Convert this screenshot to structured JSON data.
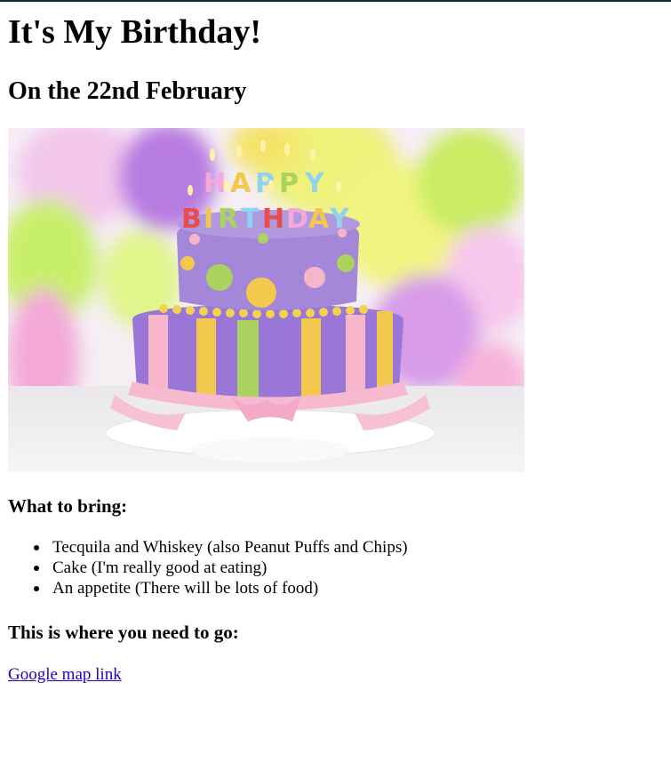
{
  "page": {
    "title": "It's My Birthday!",
    "subtitle": "On the 22nd February"
  },
  "image": {
    "description_icon": "birthday-cake-image",
    "candle_letters": "HAPPY BIRTHDAY",
    "colors": {
      "cake_top": "#a487d8",
      "cake_bottom": "#9a77d6",
      "stripe_green": "#a9d25f",
      "stripe_yellow": "#f2c94c",
      "stripe_pink": "#f6b6c9",
      "ribbon": "#f7b9cf",
      "balloon_green": "#c8ef6a",
      "balloon_yellow": "#eef27a",
      "balloon_purple": "#b77be0",
      "balloon_pink": "#f4a9d8"
    }
  },
  "bring": {
    "heading": "What to bring:",
    "items": [
      "Tecquila and Whiskey (also Peanut Puffs and Chips)",
      "Cake (I'm really good at eating)",
      "An appetite (There will be lots of food)"
    ]
  },
  "location": {
    "heading": "This is where you need to go:",
    "link_label": "Google map link"
  }
}
